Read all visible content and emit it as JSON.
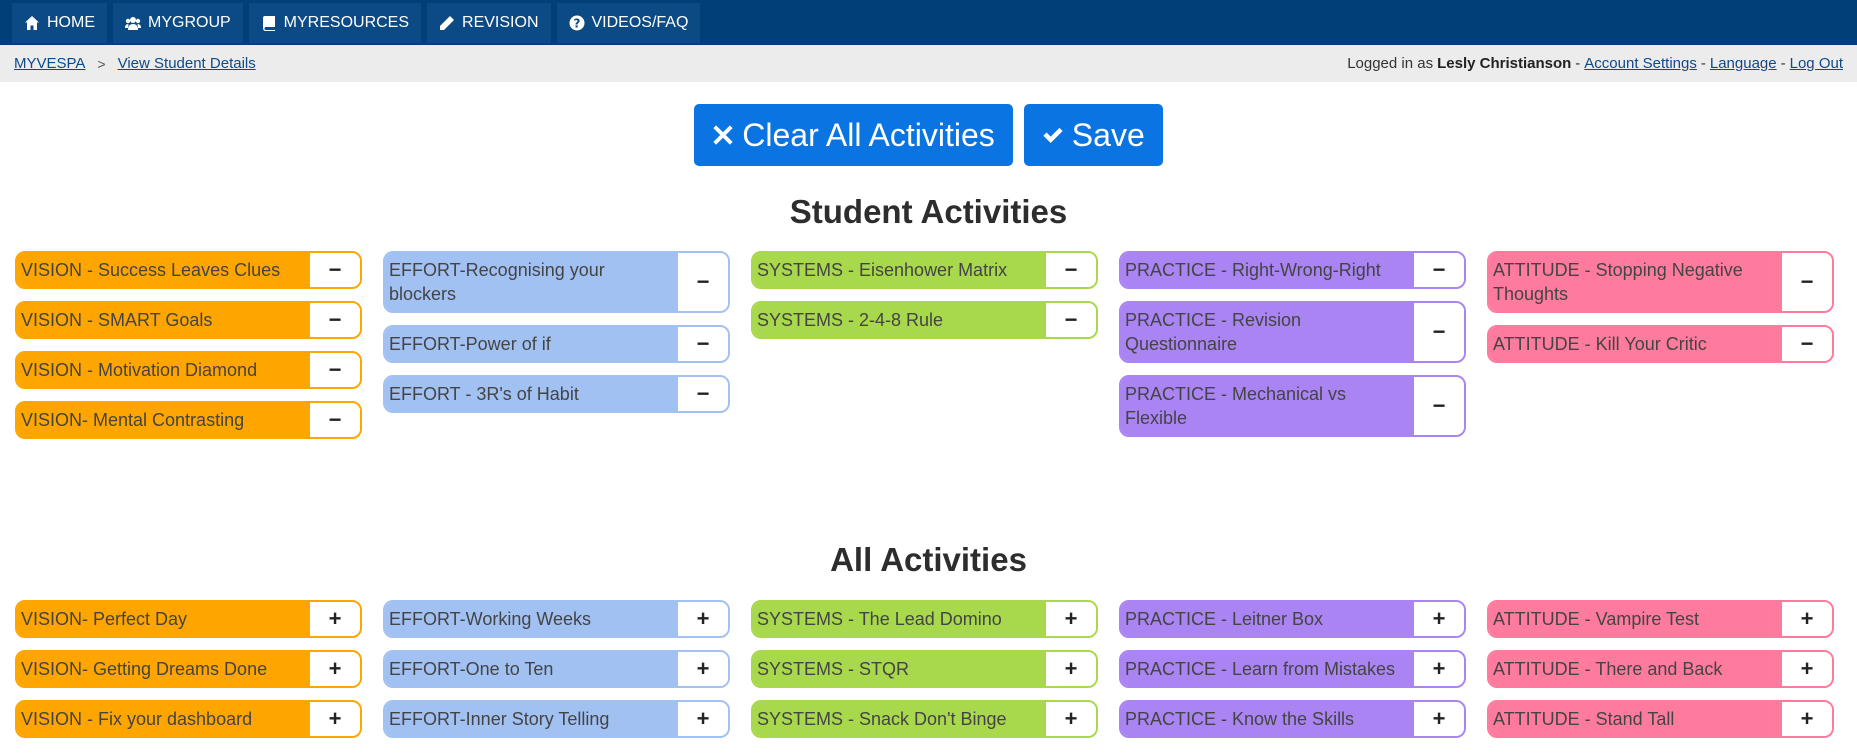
{
  "nav": {
    "items": [
      {
        "label": "HOME",
        "icon": "home-icon"
      },
      {
        "label": "MYGROUP",
        "icon": "users-icon"
      },
      {
        "label": "MYRESOURCES",
        "icon": "book-icon"
      },
      {
        "label": "REVISION",
        "icon": "pencil-icon"
      },
      {
        "label": "VIDEOS/FAQ",
        "icon": "question-circle-icon"
      }
    ]
  },
  "breadcrumb": {
    "root": "MYVESPA",
    "separator": ">",
    "current": "View Student Details"
  },
  "account": {
    "prefix": "Logged in as",
    "user": "Lesly Christianson",
    "dash": "-",
    "settings": "Account Settings",
    "language": "Language",
    "logout": "Log Out"
  },
  "actions": {
    "clear_label": "Clear All Activities",
    "save_label": "Save"
  },
  "student_title": "Student Activities",
  "all_title": "All Activities",
  "colors": {
    "topbar": "#003f78",
    "vision": "#ffa500",
    "effort": "#a2c1f3",
    "systems": "#a8d84b",
    "practice": "#a984f2",
    "attitude": "#ff7b9d",
    "button": "#0a74e3"
  },
  "student_activities": [
    {
      "category": "vision",
      "items": [
        "VISION - Success Leaves Clues",
        "VISION - SMART Goals",
        "VISION - Motivation Diamond",
        "VISION- Mental Contrasting"
      ]
    },
    {
      "category": "effort",
      "items": [
        "EFFORT-Recognising your blockers",
        "EFFORT-Power of if",
        "EFFORT - 3R's of Habit"
      ]
    },
    {
      "category": "systems",
      "items": [
        "SYSTEMS - Eisenhower Matrix",
        "SYSTEMS - 2-4-8 Rule"
      ]
    },
    {
      "category": "practice",
      "items": [
        "PRACTICE - Right-Wrong-Right",
        "PRACTICE - Revision Questionnaire",
        "PRACTICE - Mechanical vs Flexible"
      ]
    },
    {
      "category": "attitude",
      "items": [
        "ATTITUDE - Stopping Negative Thoughts",
        "ATTITUDE - Kill Your Critic"
      ]
    }
  ],
  "all_activities": [
    {
      "category": "vision",
      "items": [
        "VISION- Perfect Day",
        "VISION- Getting Dreams Done",
        "VISION - Fix your dashboard"
      ]
    },
    {
      "category": "effort",
      "items": [
        "EFFORT-Working Weeks",
        "EFFORT-One to Ten",
        "EFFORT-Inner Story Telling"
      ]
    },
    {
      "category": "systems",
      "items": [
        "SYSTEMS - The Lead Domino",
        "SYSTEMS - STQR",
        "SYSTEMS - Snack Don't Binge"
      ]
    },
    {
      "category": "practice",
      "items": [
        "PRACTICE - Leitner Box",
        "PRACTICE - Learn from Mistakes",
        "PRACTICE - Know the Skills"
      ]
    },
    {
      "category": "attitude",
      "items": [
        "ATTITUDE - Vampire Test",
        "ATTITUDE - There and Back",
        "ATTITUDE - Stand Tall"
      ]
    }
  ],
  "remove_symbol": "−",
  "add_symbol": "+"
}
